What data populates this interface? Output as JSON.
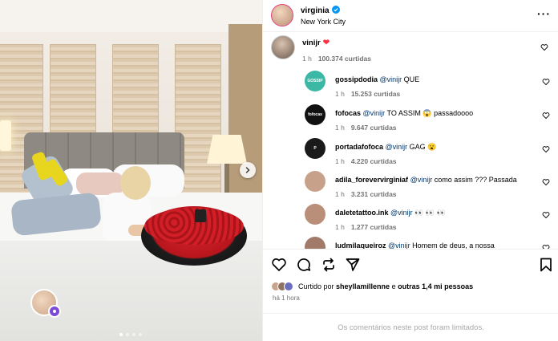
{
  "post": {
    "photo_alt": "Woman lying on a hotel bed beside a round box of red roses",
    "carousel_dots": 4,
    "active_dot": 0
  },
  "header": {
    "username": "virginia",
    "location": "New York City",
    "more_icon": "more-horizontal-icon"
  },
  "main_comment": {
    "username": "vinijr",
    "time": "1 h",
    "likes": "100.374 curtidas"
  },
  "replies": [
    {
      "username": "gossipdodia",
      "mention": "@vinijr",
      "text": " QUE",
      "time": "1 h",
      "likes": "15.253 curtidas",
      "avatar_bg": "#3bb9a6",
      "avatar_label": "GOSSIP"
    },
    {
      "username": "fofocas",
      "mention": "@vinijr",
      "text": " TO ASSIM 😱 passadoooo",
      "time": "1 h",
      "likes": "9.647 curtidas",
      "avatar_bg": "#111111",
      "avatar_label": "fofocas"
    },
    {
      "username": "portadafofoca",
      "mention": "@vinijr",
      "text": " GAG 😮",
      "time": "1 h",
      "likes": "4.220 curtidas",
      "avatar_bg": "#1a1a1a",
      "avatar_label": "P"
    },
    {
      "username": "adila_forevervirginiaf",
      "mention": "@vinijr",
      "text": " como assim ??? Passada",
      "time": "1 h",
      "likes": "3.231 curtidas",
      "avatar_bg": "#c8a18a",
      "avatar_label": ""
    },
    {
      "username": "daletetattoo.ink",
      "mention": "@vinijr",
      "text": " 👀 👀 👀",
      "time": "1 h",
      "likes": "1.277 curtidas",
      "avatar_bg": "#b98f7a",
      "avatar_label": ""
    },
    {
      "username": "ludmilaqueiroz",
      "mention": "@vinijr",
      "text": " Homem de deus, a nossa",
      "time": "",
      "likes": "",
      "avatar_bg": "#a27a6a",
      "avatar_label": ""
    }
  ],
  "actions": {
    "like": "heart-icon",
    "comment": "comment-icon",
    "share": "repost-icon",
    "send": "send-icon",
    "save": "bookmark-icon"
  },
  "liked_by": {
    "prefix": "Curtido por ",
    "user": "sheyllamillenne",
    "middle": " e ",
    "others": "outras 1,4 mi pessoas"
  },
  "posted_ago": "há 1 hora",
  "comments_limited": "Os comentários neste post foram limitados.",
  "colors": {
    "verified": "#0095f6",
    "heart": "#ff3040",
    "mention": "#00376b",
    "muted": "#737373"
  }
}
